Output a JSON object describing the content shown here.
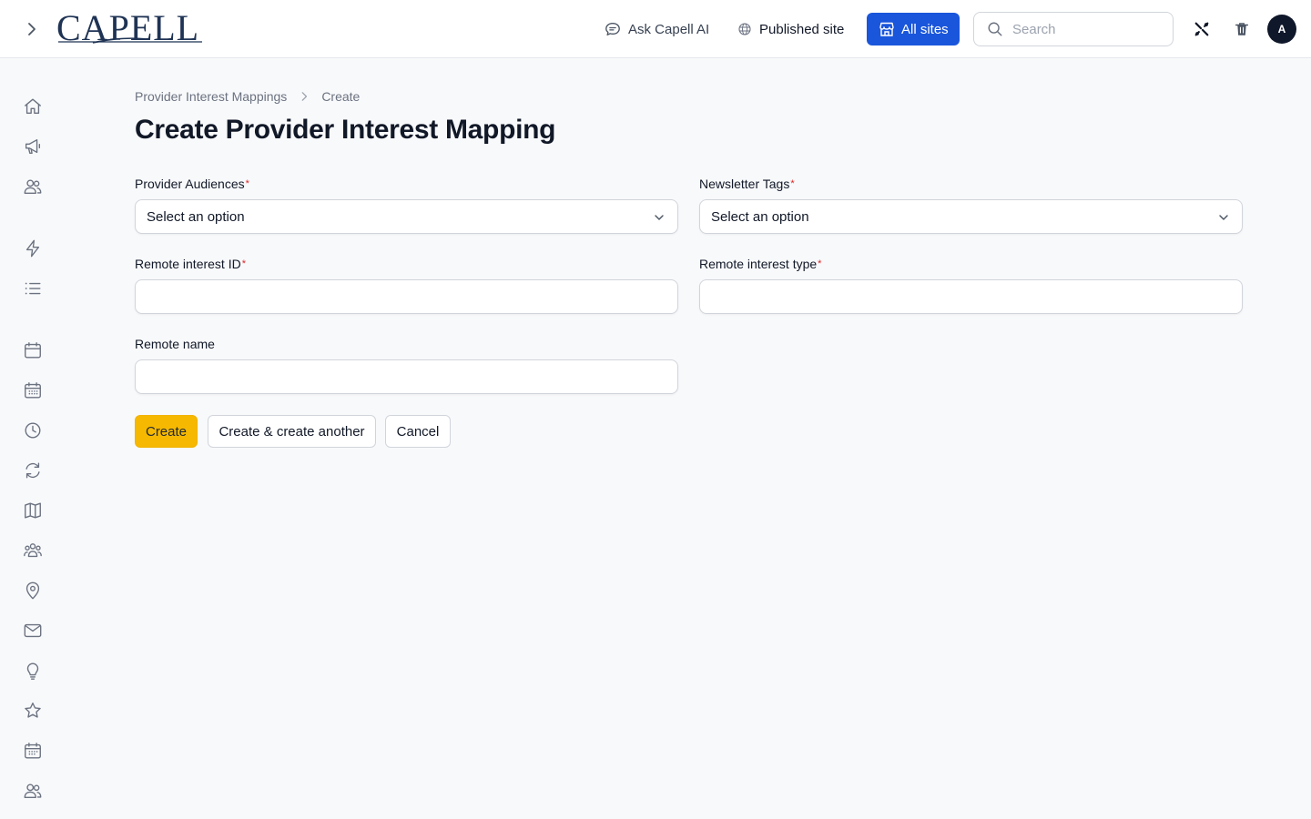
{
  "header": {
    "logo_text": "CAPELL",
    "ask_ai_label": "Ask Capell AI",
    "published_site_label": "Published site",
    "all_sites_label": "All sites",
    "search_placeholder": "Search",
    "avatar_initial": "A",
    "accent_color": "#1a56db"
  },
  "sidebar": {
    "icons": [
      "home-icon",
      "megaphone-icon",
      "users-icon",
      "bolt-icon",
      "list-icon",
      "calendar-icon",
      "calendar-grid-icon",
      "clock-icon",
      "refresh-icon",
      "map-icon",
      "user-group-icon",
      "map-pin-icon",
      "envelope-icon",
      "lightbulb-icon",
      "star-icon",
      "calendar-days-icon",
      "users-alt-icon"
    ]
  },
  "breadcrumb": {
    "parent": "Provider Interest Mappings",
    "current": "Create"
  },
  "page": {
    "title": "Create Provider Interest Mapping"
  },
  "form": {
    "provider_audiences": {
      "label": "Provider Audiences",
      "required": "*",
      "value": "Select an option"
    },
    "newsletter_tags": {
      "label": "Newsletter Tags",
      "required": "*",
      "value": "Select an option"
    },
    "remote_interest_id": {
      "label": "Remote interest ID",
      "required": "*",
      "value": ""
    },
    "remote_interest_type": {
      "label": "Remote interest type",
      "required": "*",
      "value": ""
    },
    "remote_name": {
      "label": "Remote name",
      "value": ""
    }
  },
  "actions": {
    "create": "Create",
    "create_another": "Create & create another",
    "cancel": "Cancel",
    "primary_color": "#f6b800"
  }
}
